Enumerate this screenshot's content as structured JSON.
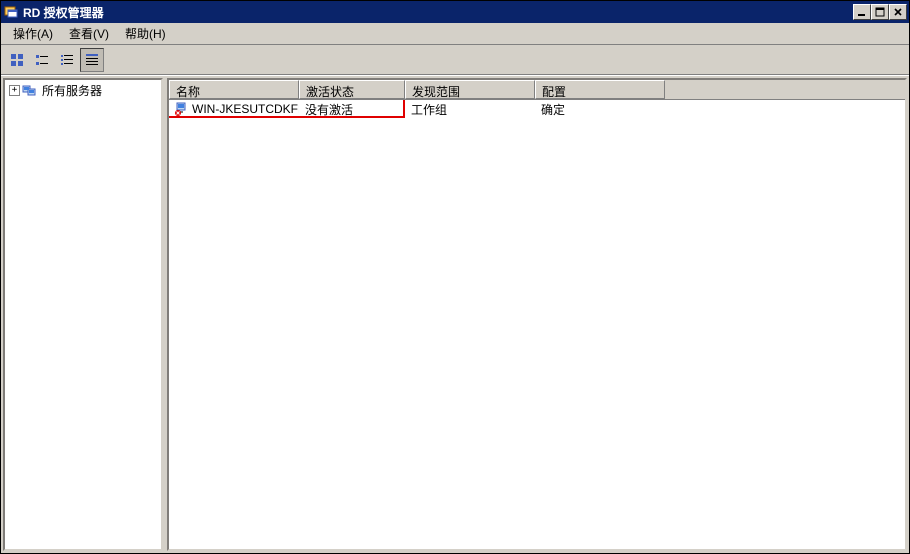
{
  "window": {
    "title": "RD 授权管理器"
  },
  "menu": {
    "action": "操作(A)",
    "view": "查看(V)",
    "help": "帮助(H)"
  },
  "tree": {
    "root": {
      "expand": "+",
      "label": "所有服务器"
    }
  },
  "list": {
    "headers": [
      "名称",
      "激活状态",
      "发现范围",
      "配置"
    ],
    "rows": [
      {
        "name": "WIN-JKESUTCDKFE",
        "status": "没有激活",
        "scope": "工作组",
        "config": "确定"
      }
    ]
  }
}
